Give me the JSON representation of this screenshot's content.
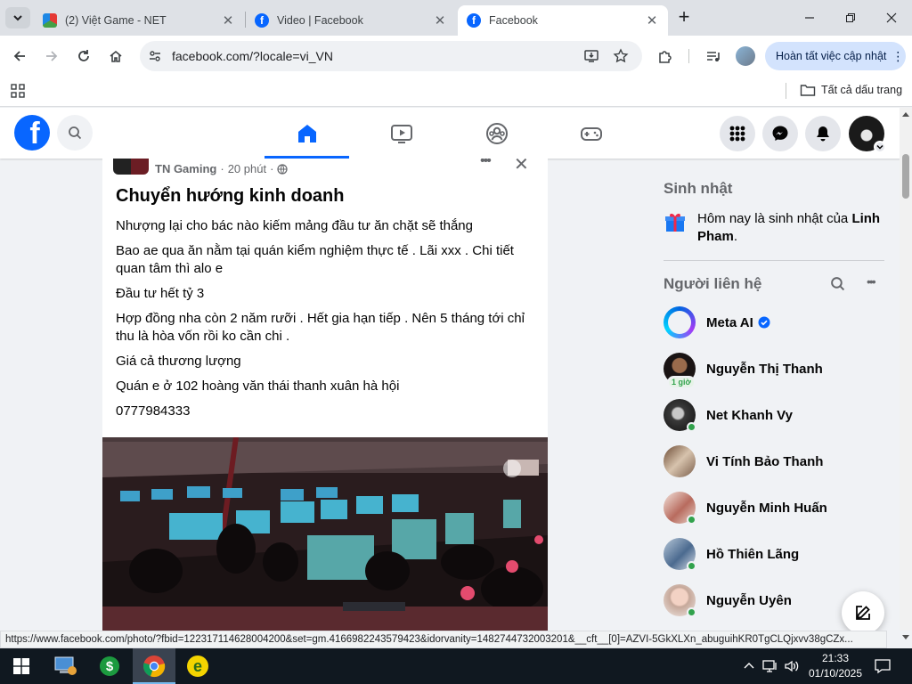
{
  "browser": {
    "tabs": [
      {
        "title": "(2) Việt Game - NET",
        "close": "✕",
        "active": false
      },
      {
        "title": "Video | Facebook",
        "close": "✕",
        "active": false
      },
      {
        "title": "Facebook",
        "close": "✕",
        "active": true
      }
    ],
    "new_tab": "+",
    "url": "facebook.com/?locale=vi_VN",
    "update_button": "Hoàn tất việc cập nhật",
    "update_menu": "⋮",
    "bookmarks_folder": "Tất cả dấu trang"
  },
  "facebook": {
    "logo": "f",
    "nav": [
      "home-icon",
      "video-icon",
      "groups-icon",
      "gaming-icon"
    ],
    "active_nav": "home-icon"
  },
  "post": {
    "author": "TN Gaming",
    "time": "20 phút",
    "more": "•••",
    "close": "✕",
    "title": "Chuyển hướng kinh doanh",
    "paragraphs": [
      "Nhượng lại cho bác nào kiếm mảng đầu tư ăn chặt sẽ thắng",
      "Bao ae qua ăn nằm tại quán kiểm nghiệm thực tế . Lãi xxx . Chi tiết quan tâm thì alo e",
      "Đầu tư hết tỷ 3",
      "Hợp đồng nha còn 2 năm rưỡi . Hết gia hạn tiếp . Nên 5 tháng tới chỉ thu là hòa vốn rồi ko cần chi .",
      "Giá cả thương lượng",
      "Quán e ở 102 hoàng văn thái thanh xuân hà hội",
      "0777984333"
    ]
  },
  "sidebar": {
    "birthday_heading": "Sinh nhật",
    "birthday_text": "Hôm nay là sinh nhật của ",
    "birthday_name": "Linh Pham",
    "birthday_end": ".",
    "contacts_heading": "Người liên hệ",
    "contacts_more": "•••",
    "contacts": [
      {
        "name": "Meta AI",
        "verified": true,
        "badge": "",
        "online": false
      },
      {
        "name": "Nguyễn Thị Thanh",
        "verified": false,
        "badge": "1 giờ",
        "online": false
      },
      {
        "name": "Net Khanh Vy",
        "verified": false,
        "badge": "",
        "online": true
      },
      {
        "name": "Vi Tính Bảo Thanh",
        "verified": false,
        "badge": "",
        "online": false
      },
      {
        "name": "Nguyễn Minh Huấn",
        "verified": false,
        "badge": "",
        "online": true
      },
      {
        "name": "Hồ Thiên Lãng",
        "verified": false,
        "badge": "",
        "online": true
      },
      {
        "name": "Nguyễn Uyên",
        "verified": false,
        "badge": "",
        "online": true
      }
    ]
  },
  "status_url": "https://www.facebook.com/photo/?fbid=122317114628004200&set=gm.4166982243579423&idorvanity=1482744732003201&__cft__[0]=AZVI-5GkXLXn_abuguihKR0TgCLQjxvv38gCZx...",
  "taskbar": {
    "time": "21:33",
    "date": "01/10/2025"
  },
  "colors": {
    "fb_blue": "#0866ff",
    "online": "#31a24c"
  }
}
